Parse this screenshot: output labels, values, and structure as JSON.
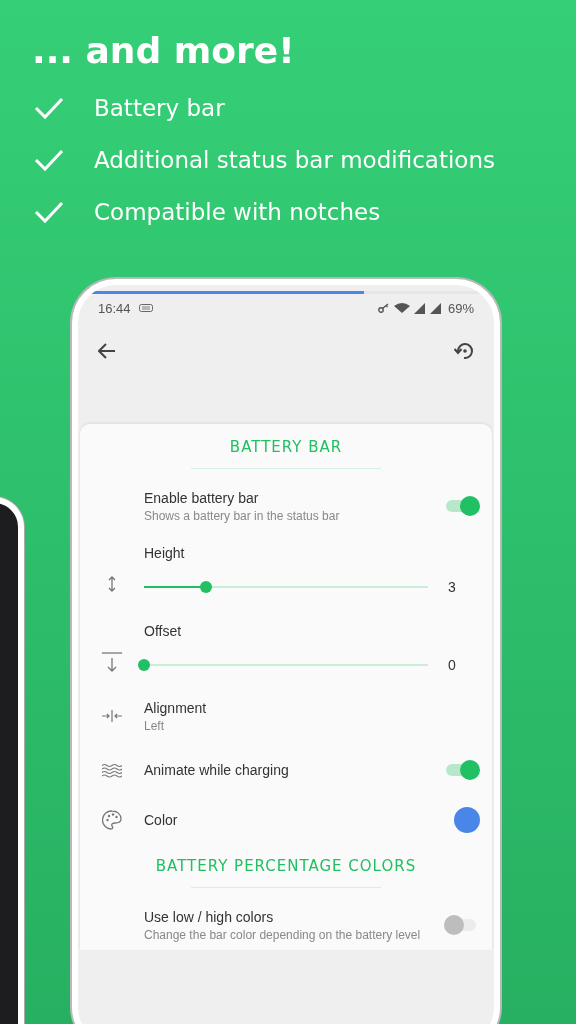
{
  "headline": "... and more!",
  "features": [
    {
      "label": "Battery bar"
    },
    {
      "label": "Additional status bar modifications"
    },
    {
      "label": "Compatible with notches"
    }
  ],
  "phone": {
    "battery_bar": {
      "level": 0.69
    },
    "status_bar": {
      "time": "16:44",
      "battery": "69%"
    },
    "sections": [
      {
        "title": "BATTERY BAR",
        "items": [
          {
            "kind": "switch",
            "title": "Enable battery bar",
            "subtitle": "Shows a battery bar in the status bar",
            "on": true
          },
          {
            "kind": "slider",
            "title": "Height",
            "level": 0.22,
            "reading": "3"
          },
          {
            "kind": "slider",
            "title": "Offset",
            "level": 0,
            "reading": "0"
          },
          {
            "kind": "value",
            "title": "Alignment",
            "subtitle": "Left"
          },
          {
            "kind": "switch",
            "title": "Animate while charging",
            "on": true
          },
          {
            "kind": "color",
            "title": "Color",
            "color": "#4a86e8"
          }
        ]
      },
      {
        "title": "BATTERY PERCENTAGE COLORS",
        "items": [
          {
            "kind": "switch",
            "title": "Use low / high colors",
            "subtitle": "Change the bar color depending on the battery level",
            "on": false
          }
        ]
      }
    ]
  }
}
